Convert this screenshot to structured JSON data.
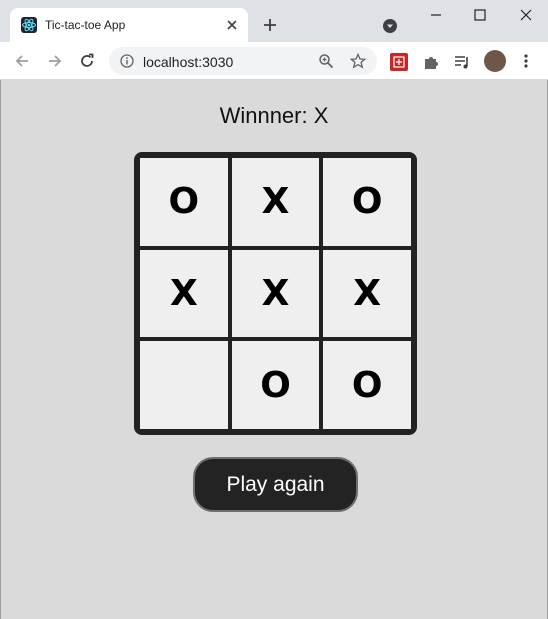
{
  "browser": {
    "tab_title": "Tic-tac-toe App",
    "url": "localhost:3030"
  },
  "game": {
    "status": "Winnner: X",
    "cells": [
      "O",
      "X",
      "O",
      "X",
      "X",
      "X",
      "",
      "O",
      "O"
    ],
    "play_again_label": "Play again"
  },
  "icons": {
    "tab_favicon": "react-icon",
    "tab_close": "close-icon",
    "new_tab": "plus-icon",
    "tab_search": "chevron-down-icon",
    "back": "arrow-left-icon",
    "forward": "arrow-right-icon",
    "reload": "reload-icon",
    "site_info": "info-icon",
    "zoom": "zoom-icon",
    "bookmark": "star-icon",
    "extensions": "puzzle-icon",
    "media": "media-control-icon",
    "menu": "kebab-icon"
  },
  "colors": {
    "page_background": "#dadada",
    "board_line": "#222222",
    "cell_background": "#efefef",
    "button_background": "#232323",
    "button_text": "#ffffff"
  }
}
